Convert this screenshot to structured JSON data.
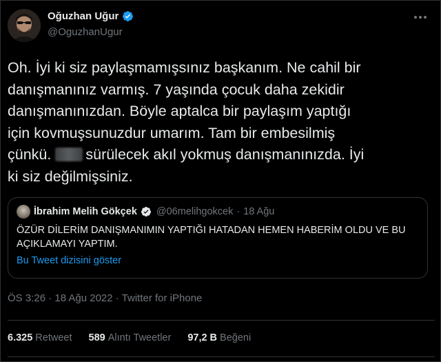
{
  "author": {
    "display_name": "Oğuzhan Uğur",
    "handle": "@OguzhanUgur"
  },
  "tweet": {
    "lines": [
      "Oh. İyi ki siz paylaşmamışsınız başkanım. Ne cahil bir",
      "danışmanınız varmış. 7 yaşında çocuk daha zekidir",
      "danışmanınızdan. Böyle aptalca bir paylaşım yaptığı",
      "için kovmuşsunuzdur umarım. Tam bir embesilmiş",
      "ki siz değilmişsiniz."
    ],
    "line6_before": "çünkü.",
    "line6_after": "sürülecek akıl yokmuş danışmanınızda. İyi"
  },
  "quote": {
    "name": "İbrahim Melih Gökçek",
    "handle": "@06melihgokcek",
    "separator": "·",
    "date": "18 Ağu",
    "text": "ÖZÜR DİLERİM DANIŞMANIMIN YAPTIĞI HATADAN HEMEN HABERİM OLDU VE BU AÇIKLAMAYI YAPTIM.",
    "thread_link": "Bu Tweet dizisini göster"
  },
  "meta": {
    "timestamp": "ÖS 3:26 · 18 Ağu 2022 · Twitter for iPhone"
  },
  "stats": {
    "retweets": "6.325",
    "retweets_label": "Retweet",
    "quotes": "589",
    "quotes_label": "Alıntı Tweetler",
    "likes": "97,2 B",
    "likes_label": "Beğeni"
  },
  "colors": {
    "background": "#000000",
    "text": "#e7e9ea",
    "muted": "#71767b",
    "link": "#1d9bf0",
    "border": "#2f3336",
    "verified": "#1d9bf0"
  },
  "icons": {
    "verified": "verified-badge-icon",
    "more": "more-options-icon"
  }
}
